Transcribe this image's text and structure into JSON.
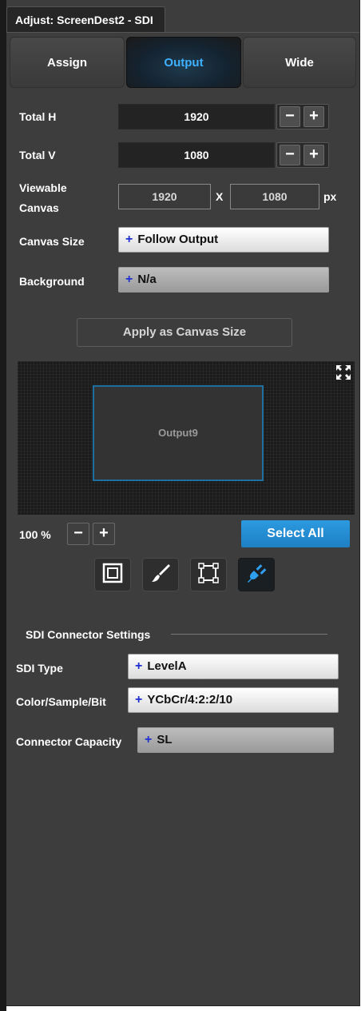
{
  "window": {
    "title": "Adjust: ScreenDest2 - SDI"
  },
  "tabs": [
    {
      "label": "Assign",
      "active": false
    },
    {
      "label": "Output",
      "active": true
    },
    {
      "label": "Wide",
      "active": false
    }
  ],
  "output": {
    "total_h": {
      "label": "Total H",
      "value": "1920",
      "minus": "−",
      "plus": "+"
    },
    "total_v": {
      "label": "Total V",
      "value": "1080",
      "minus": "−",
      "plus": "+"
    },
    "viewable_canvas": {
      "label_line1": "Viewable",
      "label_line2": "Canvas",
      "width": "1920",
      "separator": "X",
      "height": "1080",
      "unit": "px"
    },
    "canvas_size": {
      "label": "Canvas Size",
      "value": "Follow Output"
    },
    "background": {
      "label": "Background",
      "value": "N/a"
    },
    "apply_button": "Apply as Canvas Size"
  },
  "dropdown_prefix": "+",
  "canvas": {
    "output_name": "Output9",
    "zoom": "100 %",
    "zoom_minus": "−",
    "zoom_plus": "+",
    "select_all": "Select All",
    "outline_color": "#1e6ea0"
  },
  "tools": [
    {
      "icon": "frame-icon",
      "active": false
    },
    {
      "icon": "brush-icon",
      "active": false
    },
    {
      "icon": "crop-icon",
      "active": false
    },
    {
      "icon": "connector-plug-icon",
      "active": true
    }
  ],
  "sdi": {
    "section_title": "SDI Connector Settings",
    "sdi_type": {
      "label": "SDI Type",
      "value": "LevelA"
    },
    "color_sample_bit": {
      "label": "Color/Sample/Bit",
      "value": "YCbCr/4:2:2/10"
    },
    "connector_capacity": {
      "label": "Connector Capacity",
      "value": "SL"
    }
  },
  "colors": {
    "accent": "#3fb1ff",
    "select_all": "#2391d6",
    "panel": "#3d3d3d",
    "plus": "#1f2fd0"
  }
}
